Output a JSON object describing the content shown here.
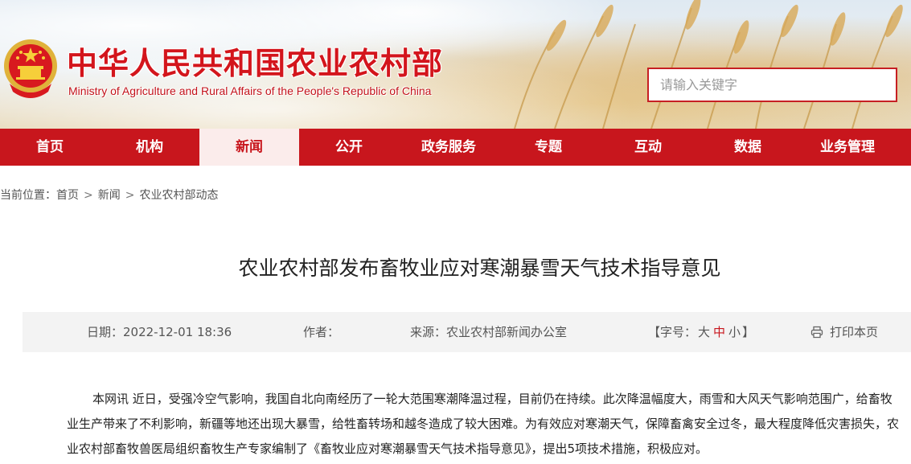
{
  "header": {
    "title_cn": "中华人民共和国农业农村部",
    "title_en": "Ministry of Agriculture and Rural Affairs of the People's Republic of China",
    "emblem_icon": "national-emblem-icon",
    "search": {
      "placeholder": "请输入关键字",
      "value": ""
    }
  },
  "nav": {
    "items": [
      "首页",
      "机构",
      "新闻",
      "公开",
      "政务服务",
      "专题",
      "互动",
      "数据",
      "业务管理"
    ],
    "active": "新闻"
  },
  "breadcrumb": {
    "prefix": "当前位置：",
    "items": [
      "首页",
      "新闻",
      "农业农村部动态"
    ],
    "separator": ">"
  },
  "article": {
    "title": "农业农村部发布畜牧业应对寒潮暴雪天气技术指导意见",
    "meta": {
      "date": "日期：2022-12-01 18:36",
      "author": "作者：",
      "source": "来源：农业农村部新闻办公室",
      "fontsize_label": "【字号：",
      "fontsize_large": "大",
      "fontsize_medium": "中",
      "fontsize_small": "小",
      "fontsize_end": "】",
      "print": "打印本页",
      "print_icon": "printer-icon"
    },
    "body": "本网讯 近日，受强冷空气影响，我国自北向南经历了一轮大范围寒潮降温过程，目前仍在持续。此次降温幅度大，雨雪和大风天气影响范围广，给畜牧业生产带来了不利影响，新疆等地还出现大暴雪，给牲畜转场和越冬造成了较大困难。为有效应对寒潮天气，保障畜禽安全过冬，最大程度降低灾害损失，农业农村部畜牧兽医局组织畜牧生产专家编制了《畜牧业应对寒潮暴雪天气技术指导意见》，提出5项技术措施，积极应对。"
  },
  "colors": {
    "brand_red": "#c8161d",
    "nav_active_bg": "#fbeceb",
    "meta_bg": "#f3f3f3"
  }
}
